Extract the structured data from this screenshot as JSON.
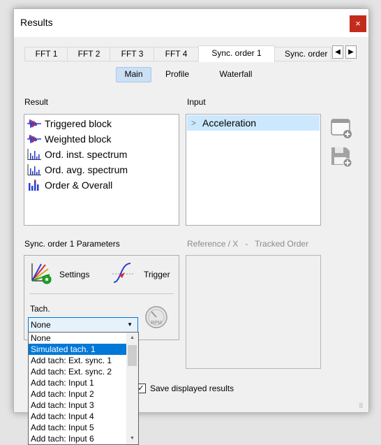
{
  "window": {
    "title": "Results",
    "close_label": "×"
  },
  "tabs": [
    "FFT 1",
    "FFT 2",
    "FFT 3",
    "FFT 4",
    "Sync. order 1",
    "Sync. order"
  ],
  "tab_scroll": {
    "left": "◀",
    "right": "▶"
  },
  "subtabs": [
    "Main",
    "Profile",
    "Waterfall"
  ],
  "result": {
    "label": "Result",
    "items": [
      "Triggered block",
      "Weighted block",
      "Ord. inst. spectrum",
      "Ord. avg. spectrum",
      "Order & Overall"
    ],
    "icons": [
      "waveform-icon",
      "waveform-icon",
      "spectrum-icon",
      "spectrum-icon",
      "order-bars-icon"
    ]
  },
  "input": {
    "label": "Input",
    "expander": ">",
    "item": "Acceleration"
  },
  "side_buttons": [
    "add-window-icon",
    "save-add-icon"
  ],
  "params": {
    "title": "Sync. order 1  Parameters",
    "settings_label": "Settings",
    "trigger_label": "Trigger",
    "tach_label": "Tach.",
    "tach_value": "None",
    "rpm_label": "RPM"
  },
  "reference": {
    "label": "Reference / X   -   Tracked Order"
  },
  "dropdown": {
    "items": [
      "None",
      "Simulated tach. 1",
      "Add tach: Ext. sync. 1",
      "Add tach: Ext. sync. 2",
      "Add tach: Input 1",
      "Add tach: Input 2",
      "Add tach: Input 3",
      "Add tach: Input 4",
      "Add tach: Input 5",
      "Add tach: Input 6"
    ],
    "selected": 1
  },
  "save_results": {
    "label": "Save displayed results",
    "checked": "✓"
  },
  "colors": {
    "accent": "#0078d7",
    "close": "#c42b1c",
    "selection": "#cce8ff"
  }
}
